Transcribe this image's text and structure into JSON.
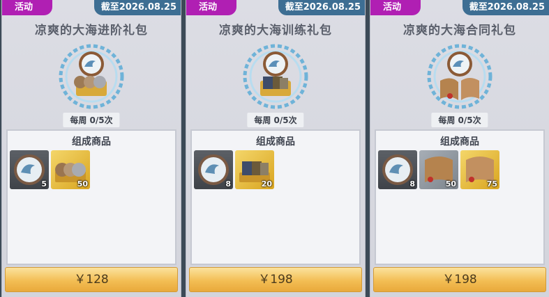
{
  "packs": [
    {
      "tag": "活动",
      "deadline": "截至2026.08.25",
      "title": "凉爽的大海进阶礼包",
      "limit": "每周 0/5次",
      "contents_title": "组成商品",
      "items": [
        {
          "icon": "wave-coin-icon",
          "qty": "5"
        },
        {
          "icon": "coins-stack-icon",
          "qty": "50"
        }
      ],
      "price": "￥128"
    },
    {
      "tag": "活动",
      "deadline": "截至2026.08.25",
      "title": "凉爽的大海训练礼包",
      "limit": "每周 0/5次",
      "contents_title": "组成商品",
      "items": [
        {
          "icon": "wave-coin-icon",
          "qty": "8"
        },
        {
          "icon": "training-books-icon",
          "qty": "20"
        }
      ],
      "price": "￥198"
    },
    {
      "tag": "活动",
      "deadline": "截至2026.08.25",
      "title": "凉爽的大海合同礼包",
      "limit": "每周 0/5次",
      "contents_title": "组成商品",
      "items": [
        {
          "icon": "wave-coin-icon",
          "qty": "8"
        },
        {
          "icon": "contract-scroll-icon",
          "qty": "50"
        },
        {
          "icon": "contract-scroll-gold-icon",
          "qty": "75"
        }
      ],
      "price": "￥198"
    }
  ],
  "colors": {
    "tag": "#b01fb3",
    "deadline": "#3d6e93",
    "button": "#f3be54"
  }
}
